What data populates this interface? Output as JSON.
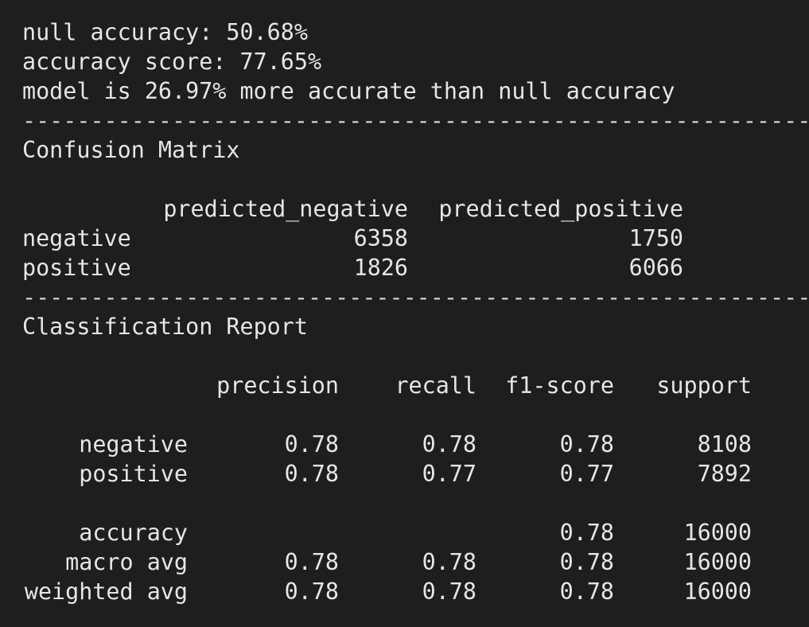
{
  "summary": {
    "null_accuracy": "null accuracy: 50.68%",
    "accuracy_score": "accuracy score: 77.65%",
    "comparison": "model is 26.97% more accurate than null accuracy"
  },
  "divider": "------------------------------------------------------------",
  "confusion_matrix": {
    "title": "Confusion Matrix",
    "columns": [
      "predicted_negative",
      "predicted_positive"
    ],
    "rows": [
      {
        "label": "negative",
        "values": [
          "6358",
          "1750"
        ]
      },
      {
        "label": "positive",
        "values": [
          "1826",
          "6066"
        ]
      }
    ]
  },
  "classification_report": {
    "title": "Classification Report",
    "columns": [
      "precision",
      "recall",
      "f1-score",
      "support"
    ],
    "class_rows": [
      {
        "label": "negative",
        "values": [
          "0.78",
          "0.78",
          "0.78",
          "8108"
        ]
      },
      {
        "label": "positive",
        "values": [
          "0.78",
          "0.77",
          "0.77",
          "7892"
        ]
      }
    ],
    "summary_rows": [
      {
        "label": "accuracy",
        "values": [
          "",
          "",
          "0.78",
          "16000"
        ]
      },
      {
        "label": "macro avg",
        "values": [
          "0.78",
          "0.78",
          "0.78",
          "16000"
        ]
      },
      {
        "label": "weighted avg",
        "values": [
          "0.78",
          "0.78",
          "0.78",
          "16000"
        ]
      }
    ]
  }
}
